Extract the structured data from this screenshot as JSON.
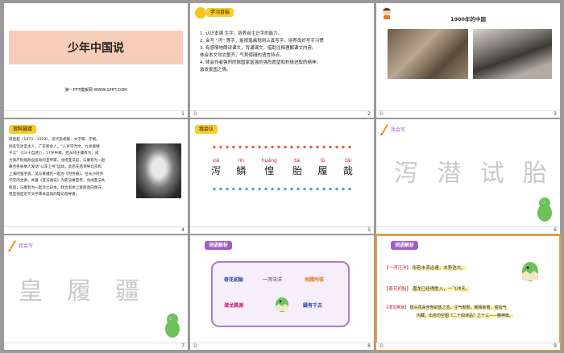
{
  "slides": [
    {
      "num": "1",
      "title": "少年中国说",
      "subtitle": "第一PPT模板网-WWW.1PPT.COM"
    },
    {
      "num": "2",
      "heading": "学习目标",
      "items": [
        "1. 认识本课 生字，培养自主识字的能力。",
        "2. 会写 “泻” 等字，能按笔画规则认真写字，培养良好写字习惯",
        "3. 有感情地朗读课文，背诵课文，借助注释理解课文内容;",
        "体会本文句式整齐，气势磅礴的语言特点。",
        "4. 体会作者强烈的振国家富强的强烈愿望和积极进取的精神，",
        "激发爱国之情。"
      ]
    },
    {
      "num": "3",
      "caption": "1900年的中国"
    },
    {
      "num": "4",
      "heading": "资料链接",
      "lines": [
        "梁启超（1873—1929），近代思想家、文学家、学者。",
        "别名饮冰室主人，广东新会人。“八岁学为文，九岁能缀",
        "千言”（《三十自述》），17岁中举。后从师于康有为，成",
        "为资产阶级改良运动的宣传家。戊戌变法前，与康有为一起",
        "联合各省举人发动“公车上书”运动，此后先后领导北京和",
        "上海的强学会，又与黄遵宪一起办《时务报》，任长沙时务",
        "学堂的主讲，并著《变法通议》为变法做宣传。戊戌变法失",
        "败后，与康有为一起流亡日本，政治思想上逐渐退向保守，",
        "但是他是近代文学革命运动的理论倡导者。"
      ]
    },
    {
      "num": "5",
      "heading": "我会认",
      "words": [
        {
          "pinyin": "xiè",
          "hanzi": "泻"
        },
        {
          "pinyin": "lín",
          "hanzi": "鳞"
        },
        {
          "pinyin": "huáng",
          "hanzi": "惶"
        },
        {
          "pinyin": "tāi",
          "hanzi": "胎"
        },
        {
          "pinyin": "lǚ",
          "hanzi": "履"
        },
        {
          "pinyin": "zāi",
          "hanzi": "哉"
        }
      ]
    },
    {
      "num": "6",
      "heading": "我会写",
      "chars": [
        "泻",
        "潜",
        "试",
        "胎"
      ]
    },
    {
      "num": "7",
      "heading": "我会写",
      "chars": [
        "皇",
        "履",
        "疆"
      ]
    },
    {
      "num": "8",
      "heading": "词语解析",
      "terms": [
        "奇花初胎",
        "一泻汪洋",
        "地腾所骇",
        "潜龙腾渊",
        "疑有千古"
      ]
    },
    {
      "num": "9",
      "heading": "词语解析",
      "defs": [
        {
          "term": "【一泻汪洋】",
          "text": "形容水流迅速，水势浩大。"
        },
        {
          "term": "【奇花初胎】",
          "text": "潜龙已经得胜入，一飞冲天。"
        },
        {
          "term": "【潜龙腾渊】",
          "text": "枝头花朵含苞欲放之态，生气勃勃，朝晖新着，喻指气"
        },
        {
          "term": "",
          "text": "内藏。出自司空图《二十四诗品》之十三——精神篇。"
        }
      ]
    }
  ],
  "footer_mark": "治",
  "colors": {
    "accent": "#f0a030",
    "title_band": "#f6cdb8",
    "badge_yellow": "#f2cf2c",
    "badge_purple": "#a05cc8",
    "red_text": "#c02020"
  }
}
